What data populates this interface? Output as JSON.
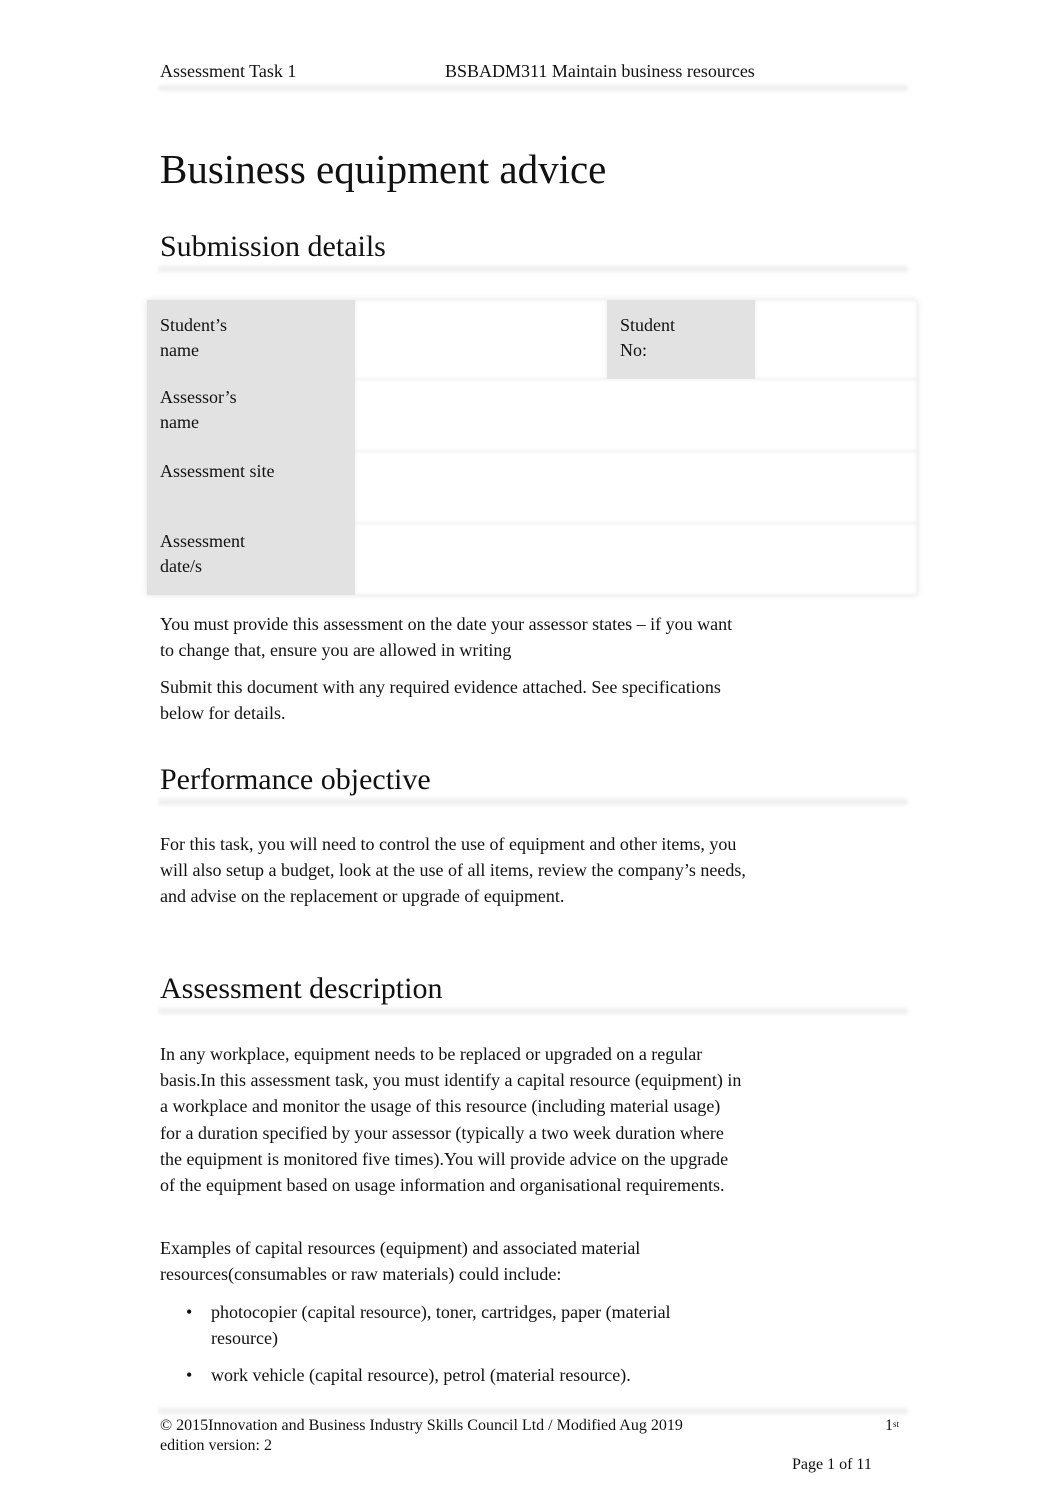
{
  "header": {
    "left": "Assessment Task 1",
    "center": "BSBADM311 Maintain business resources"
  },
  "title": "Business equipment advice",
  "submission": {
    "heading": "Submission details",
    "fields": {
      "student_name_label": "Student’s name",
      "student_no_label": "Student No:",
      "assessor_name_label": "Assessor’s name",
      "assessment_site_label": "Assessment site",
      "assessment_dates_label": "Assessment date/s"
    },
    "values": {
      "student_name": "",
      "student_no": "",
      "assessor_name": "",
      "assessment_site": "",
      "assessment_dates": ""
    },
    "notes": [
      "You must provide this assessment on the date your assessor states – if you want to change that, ensure you are allowed in writing",
      "Submit this document with any required evidence attached. See specifications below for details."
    ]
  },
  "performance": {
    "heading": "Performance objective",
    "text": "For this task, you will need to control the use of equipment and other items, you will also setup a budget, look at the use of all items, review the company’s needs, and advise on the replacement or upgrade of equipment."
  },
  "description": {
    "heading": "Assessment description",
    "paragraphs": [
      "In any workplace, equipment needs to be replaced or upgraded on a regular basis.In this assessment task, you must identify a capital resource (equipment) in a workplace and monitor the usage of this resource (including material usage) for a duration specified by your assessor (typically a two week duration where the equipment is monitored five times).You will provide advice on the upgrade of the equipment based on usage information and organisational requirements.",
      "Examples of capital resources (equipment) and associated material resources(consumables or raw materials) could include:"
    ],
    "bullet_glyph": "•",
    "bullets": [
      "photocopier (capital resource), toner, cartridges, paper (material resource)",
      "work vehicle (capital resource), petrol (material resource)."
    ]
  },
  "footer": {
    "copyright": "© 2015Innovation and Business Industry Skills Council Ltd / Modified Aug 2019",
    "edition_num": "1",
    "edition_sup": "st",
    "edition_rest": "edition version: 2",
    "page": "Page 1 of 11"
  }
}
